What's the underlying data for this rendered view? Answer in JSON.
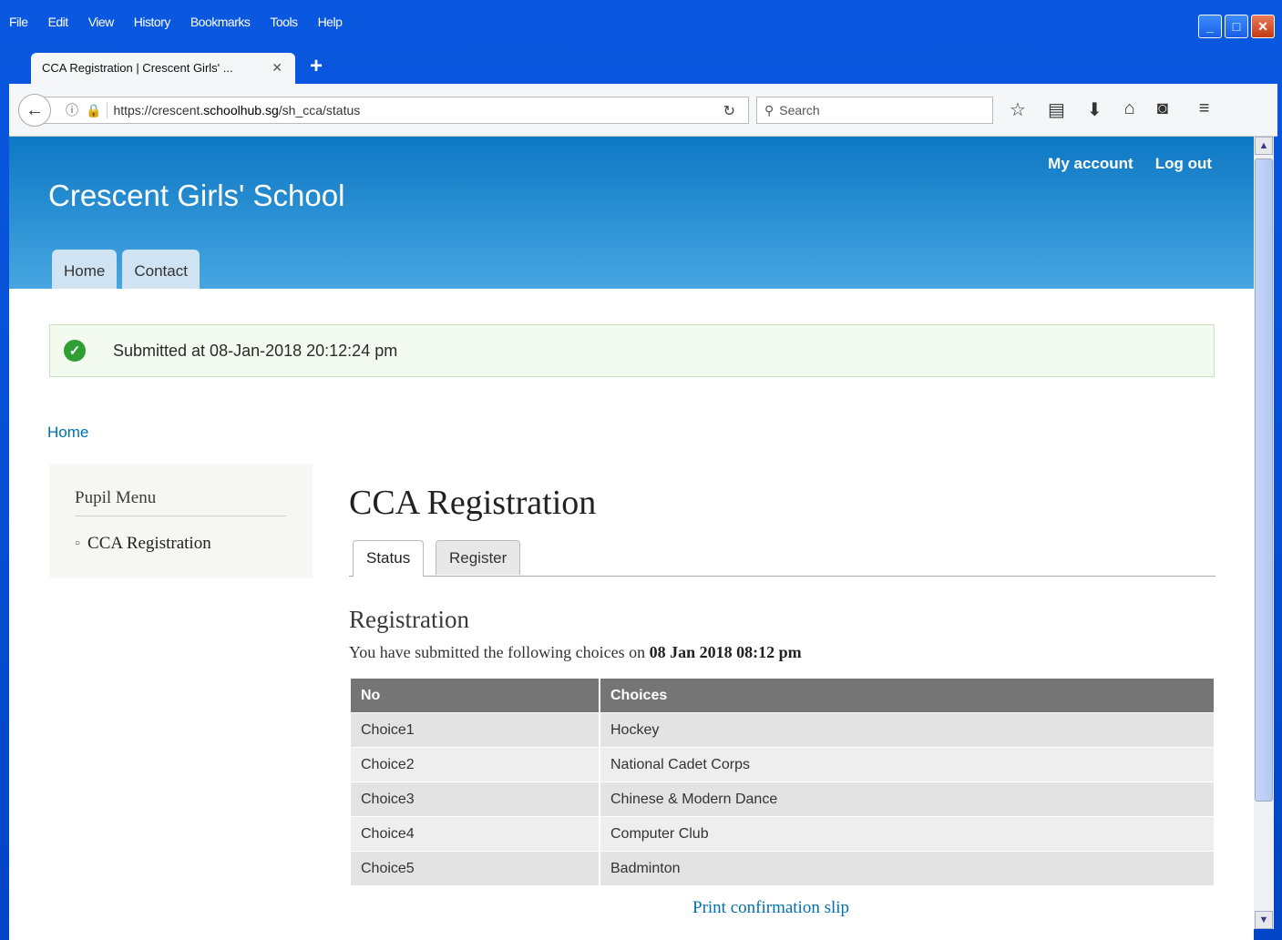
{
  "menubar": {
    "file": "File",
    "edit": "Edit",
    "view": "View",
    "history": "History",
    "bookmarks": "Bookmarks",
    "tools": "Tools",
    "help": "Help"
  },
  "browser": {
    "tab_title": "CCA Registration | Crescent Girls' ...",
    "url_prefix": "https://crescent.",
    "url_domain": "schoolhub.sg",
    "url_path": "/sh_cca/status",
    "search_placeholder": "Search"
  },
  "header": {
    "site_name": "Crescent Girls' School",
    "secondary_links": [
      "My account",
      "Log out"
    ],
    "primary_tabs": [
      "Home",
      "Contact"
    ]
  },
  "message": "Submitted at 08-Jan-2018 20:12:24 pm",
  "breadcrumb": "Home",
  "sidebar": {
    "title": "Pupil Menu",
    "items": [
      "CCA Registration"
    ]
  },
  "main": {
    "title": "CCA Registration",
    "tabs": [
      "Status",
      "Register"
    ],
    "subtitle": "Registration",
    "desc_prefix": "You have submitted the following choices on ",
    "desc_date": "08 Jan 2018 08:12 pm",
    "table": {
      "headers": [
        "No",
        "Choices"
      ],
      "rows": [
        [
          "Choice1",
          "Hockey"
        ],
        [
          "Choice2",
          "National Cadet Corps"
        ],
        [
          "Choice3",
          "Chinese & Modern Dance"
        ],
        [
          "Choice4",
          "Computer Club"
        ],
        [
          "Choice5",
          "Badminton"
        ]
      ]
    },
    "print_link": "Print confirmation slip"
  }
}
